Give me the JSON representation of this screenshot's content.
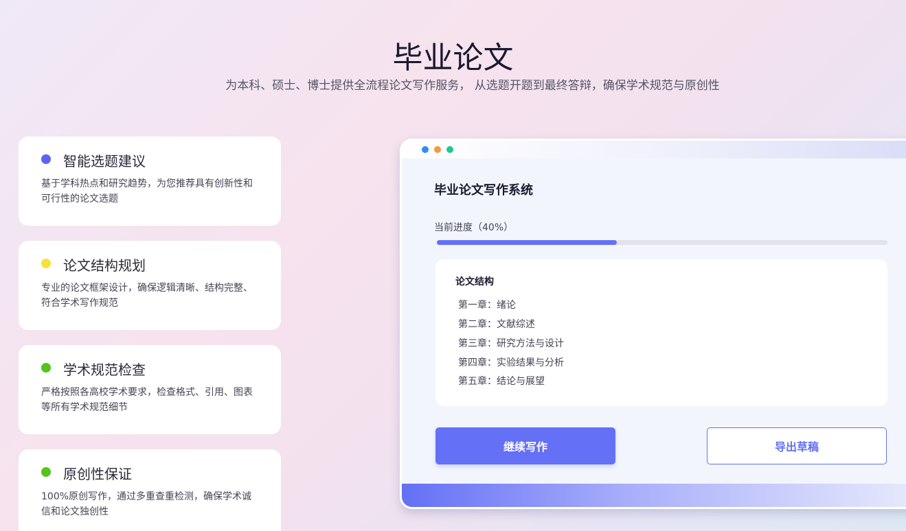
{
  "hero": {
    "title": "毕业论文",
    "subtitle": "为本科、硕士、博士提供全流程论文写作服务， 从选题开题到最终答辩，确保学术规范与原创性"
  },
  "features": [
    {
      "title": "智能选题建议",
      "desc": "基于学科热点和研究趋势，为您推荐具有创新性和可行性的论文选题",
      "dot_color": "#5b63f0",
      "icon": "blue-dot-icon"
    },
    {
      "title": "论文结构规划",
      "desc": "专业的论文框架设计，确保逻辑清晰、结构完整、符合学术写作规范",
      "dot_color": "#f7e13a",
      "icon": "yellow-dot-icon"
    },
    {
      "title": "学术规范检查",
      "desc": "严格按照各高校学术要求，检查格式、引用、图表等所有学术规范细节",
      "dot_color": "#52c41a",
      "icon": "green-dot-icon"
    },
    {
      "title": "原创性保证",
      "desc": "100%原创写作，通过多重查重检测，确保学术诚信和论文独创性",
      "dot_color": "#52c41a",
      "icon": "green-dot-icon"
    }
  ],
  "window": {
    "traffic_lights": [
      "#2f8cf5",
      "#f59a3c",
      "#1fc98e"
    ],
    "title": "毕业论文写作系统",
    "progress_label": "当前进度（40%）",
    "progress": 0.4,
    "structure": {
      "title": "论文结构",
      "chapters": [
        "第一章：绪论",
        "第二章：文献综述",
        "第三章：研究方法与设计",
        "第四章：实验结果与分析",
        "第五章：结论与展望"
      ]
    },
    "continue_label": "继续写作",
    "export_label": "导出草稿"
  },
  "colors": {
    "accent": "#6470f5"
  }
}
